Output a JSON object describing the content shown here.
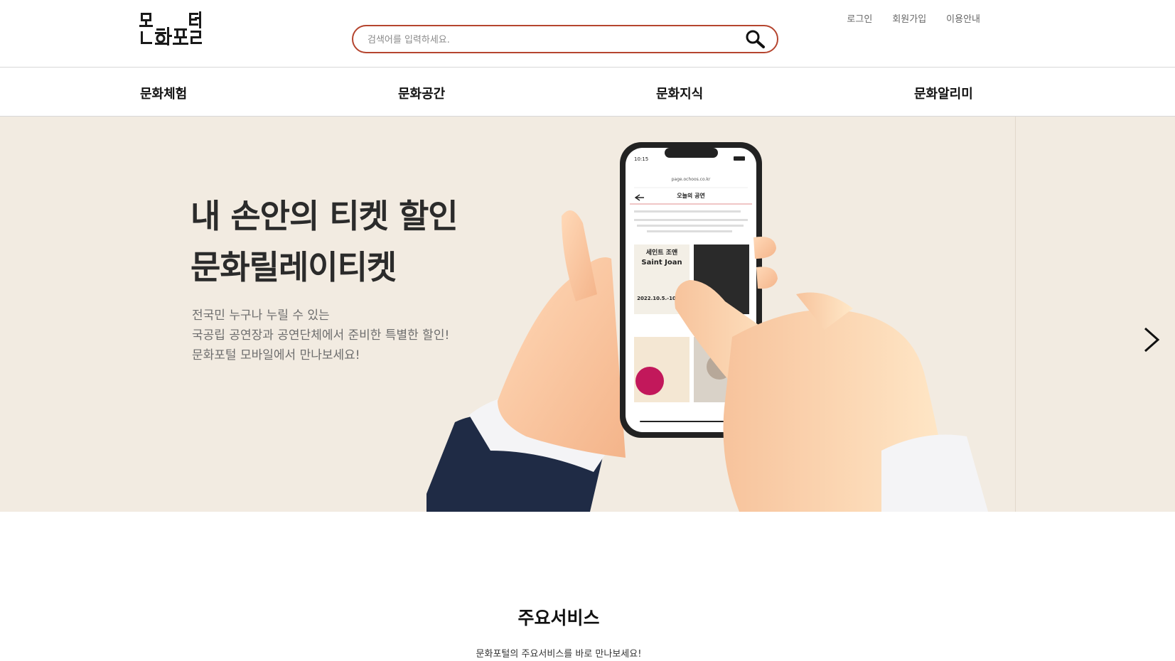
{
  "header": {
    "logo_text": "문화포털",
    "search": {
      "placeholder": "검색어를 입력하세요."
    },
    "util_links": [
      "로그인",
      "회원가입",
      "이용안내"
    ]
  },
  "nav": {
    "items": [
      "문화체험",
      "문화공간",
      "문화지식",
      "문화알리미"
    ]
  },
  "banner": {
    "title_lines": [
      "내 손안의 티켓 할인",
      "문화릴레이티켓"
    ],
    "desc_lines": [
      "전국민 누구나 누릴 수 있는",
      "국공립 공연장과 공연단체에서 준비한 특별한 할인!",
      "문화포털 모바일에서 만나보세요!"
    ],
    "phone": {
      "status_time": "10:15",
      "url": "page.ochoos.co.kr",
      "page_title": "오늘의 공연",
      "poster1_title_ko": "세인트 조앤",
      "poster1_title_en": "Saint Joan",
      "poster1_date": "2022.10.5.-10.30."
    }
  },
  "services": {
    "title": "주요서비스",
    "subtitle": "문화포털의 주요서비스를 바로 만나보세요!"
  },
  "colors": {
    "search_border": "#b5452f",
    "banner_bg": "#f2ebe1",
    "title_text": "#2b2b2b",
    "desc_text": "#6d6d6d"
  },
  "icons": {
    "search": "search-icon",
    "next": "chevron-right-icon"
  }
}
